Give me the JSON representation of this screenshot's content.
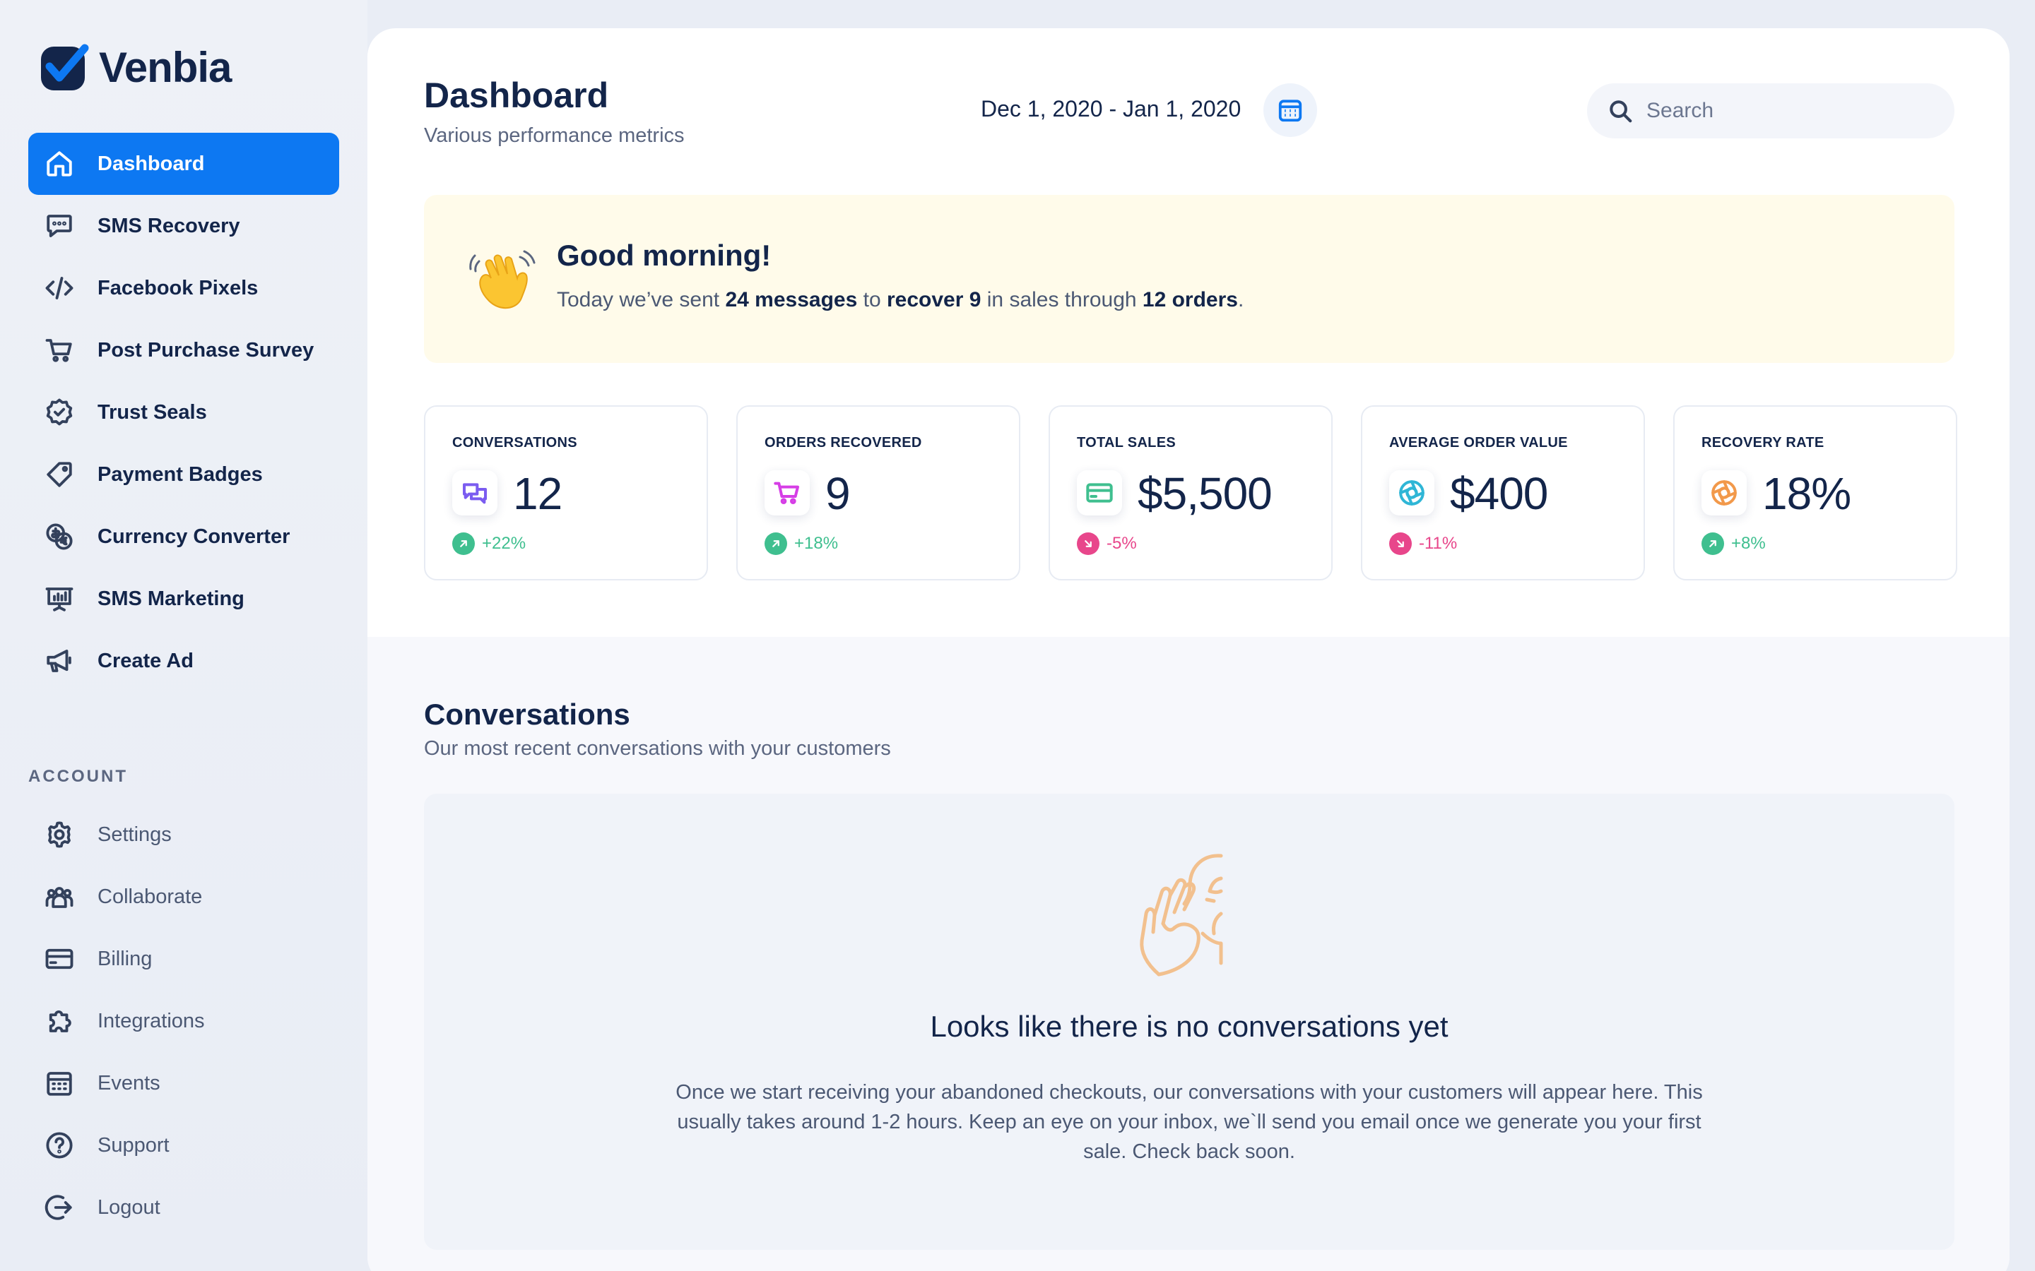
{
  "app": {
    "brand": "Venbia",
    "brand_color": "#0d78f2"
  },
  "sidebar": {
    "main_items": [
      {
        "label": "Dashboard",
        "icon": "home-icon",
        "active": true
      },
      {
        "label": "SMS Recovery",
        "icon": "chat-icon"
      },
      {
        "label": "Facebook Pixels",
        "icon": "code-icon"
      },
      {
        "label": "Post Purchase Survey",
        "icon": "cart-icon"
      },
      {
        "label": "Trust Seals",
        "icon": "badge-check-icon"
      },
      {
        "label": "Payment Badges",
        "icon": "tag-icon"
      },
      {
        "label": "Currency Converter",
        "icon": "currency-icon"
      },
      {
        "label": "SMS Marketing",
        "icon": "presentation-icon"
      },
      {
        "label": "Create Ad",
        "icon": "megaphone-icon"
      }
    ],
    "account_section_label": "ACCOUNT",
    "account_items": [
      {
        "label": "Settings",
        "icon": "gear-icon"
      },
      {
        "label": "Collaborate",
        "icon": "users-icon"
      },
      {
        "label": "Billing",
        "icon": "credit-card-icon"
      },
      {
        "label": "Integrations",
        "icon": "puzzle-icon"
      },
      {
        "label": "Events",
        "icon": "calendar-icon"
      },
      {
        "label": "Support",
        "icon": "help-icon"
      },
      {
        "label": "Logout",
        "icon": "logout-icon"
      }
    ]
  },
  "header": {
    "title": "Dashboard",
    "subtitle": "Various performance metrics",
    "date_range": "Dec 1, 2020 - Jan 1, 2020",
    "search_placeholder": "Search"
  },
  "greeting": {
    "title": "Good morning!",
    "text_parts": {
      "p1": "Today we’ve sent ",
      "b1": "24 messages",
      "p2": " to ",
      "b2": "recover 9",
      "p3": " in sales through ",
      "b3": "12 orders",
      "p4": "."
    }
  },
  "stats": [
    {
      "label": "CONVERSATIONS",
      "value": "12",
      "change": "+22%",
      "direction": "up",
      "icon": "chat-bubbles-icon",
      "icon_color": "#7b5cf0"
    },
    {
      "label": "ORDERS RECOVERED",
      "value": "9",
      "change": "+18%",
      "direction": "up",
      "icon": "cart-icon",
      "icon_color": "#d63ee6"
    },
    {
      "label": "TOTAL SALES",
      "value": "$5,500",
      "change": "-5%",
      "direction": "down",
      "icon": "credit-card-icon",
      "icon_color": "#3fbf8f"
    },
    {
      "label": "AVERAGE ORDER VALUE",
      "value": "$400",
      "change": "-11%",
      "direction": "down",
      "icon": "aperture-icon",
      "icon_color": "#2fb6d6"
    },
    {
      "label": "RECOVERY RATE",
      "value": "18%",
      "change": "+8%",
      "direction": "up",
      "icon": "aperture-icon",
      "icon_color": "#f2994a"
    }
  ],
  "conversations": {
    "title": "Conversations",
    "subtitle": "Our most recent conversations with your customers",
    "empty_title": "Looks like there is no conversations yet",
    "empty_text": "Once we start receiving your abandoned checkouts, our conversations with your customers will appear here. This usually takes around 1-2 hours. Keep an eye on your inbox, we`ll send you email once we generate you your first sale. Check back soon."
  }
}
